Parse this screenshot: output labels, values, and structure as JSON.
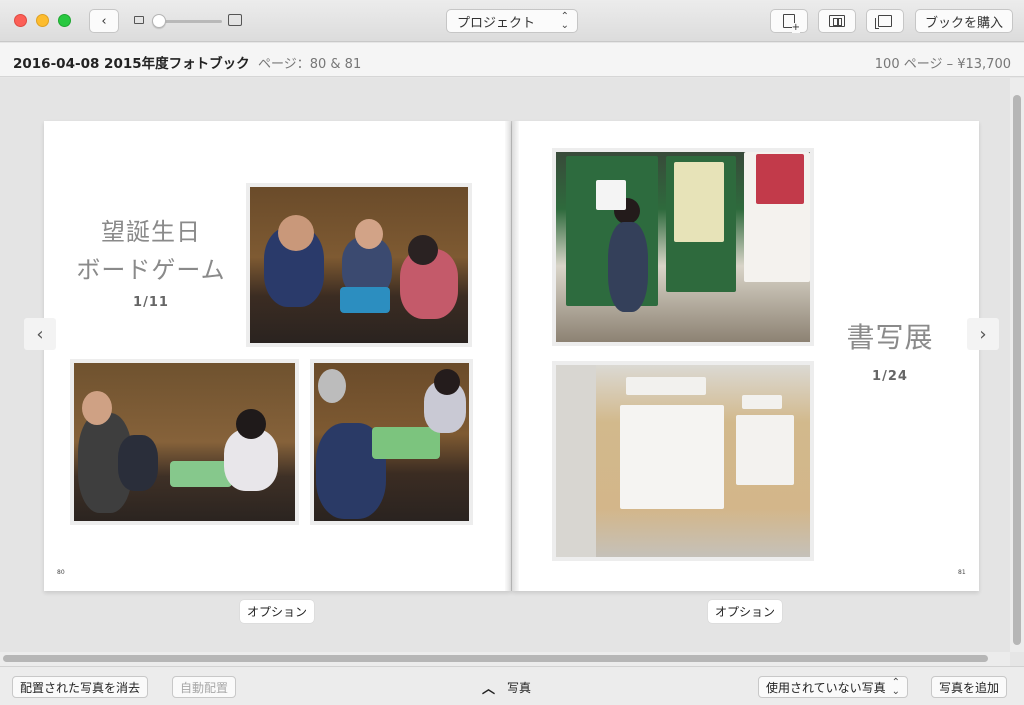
{
  "toolbar": {
    "project_select": "プロジェクト",
    "buy_book": "ブックを購入"
  },
  "infobar": {
    "book_title": "2016-04-08 2015年度フォトブック",
    "pages": "ページ：80 & 81",
    "price": "100 ページ – ¥13,700"
  },
  "left_page": {
    "title_line1": "望誕生日",
    "title_line2": "ボードゲーム",
    "count": "1/11",
    "folio": "80",
    "options": "オプション"
  },
  "right_page": {
    "title": "書写展",
    "count": "1/24",
    "folio": "81",
    "options": "オプション"
  },
  "bottombar": {
    "clear_placed": "配置された写真を消去",
    "autofill": "自動配置",
    "photos": "写真",
    "unused_select": "使用されていない写真",
    "add_photos": "写真を追加"
  },
  "colors": {
    "close": "#fc5f57",
    "minimize": "#fdbc2e",
    "zoom": "#28c840"
  }
}
